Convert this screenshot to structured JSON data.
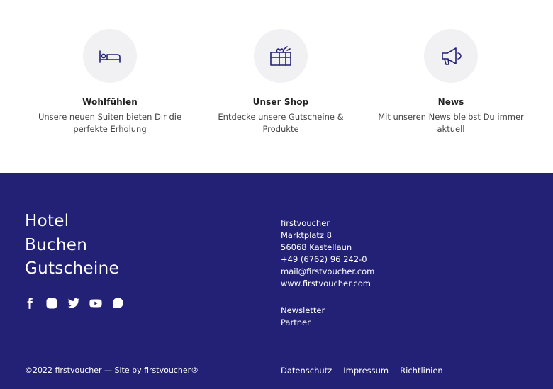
{
  "features": [
    {
      "title": "Wohlfühlen",
      "text": "Unsere neuen Suiten bieten Dir die perfekte Erholung",
      "icon": "bed-icon"
    },
    {
      "title": "Unser Shop",
      "text": "Entdecke unsere Gutscheine & Produkte",
      "icon": "gift-icon"
    },
    {
      "title": "News",
      "text": "Mit unseren News bleibst Du immer aktuell",
      "icon": "megaphone-icon"
    }
  ],
  "footer": {
    "brand": [
      "Hotel",
      "Buchen",
      "Gutscheine"
    ],
    "social": [
      "facebook-icon",
      "instagram-icon",
      "twitter-icon",
      "youtube-icon",
      "whatsapp-icon"
    ],
    "contact": [
      "firstvoucher",
      "Marktplatz 8",
      "56068 Kastellaun",
      "+49 (6762) 96 242-0",
      "mail@firstvoucher.com",
      "www.firstvoucher.com"
    ],
    "links": [
      "Newsletter",
      "Partner"
    ],
    "copyright": "©2022 firstvoucher — Site by firstvoucher®",
    "legal": [
      "Datenschutz",
      "Impressum",
      "Richtlinien"
    ]
  },
  "colors": {
    "footer_bg": "#232175",
    "icon_stroke": "#232175",
    "icon_bg": "#f1f1f3"
  }
}
